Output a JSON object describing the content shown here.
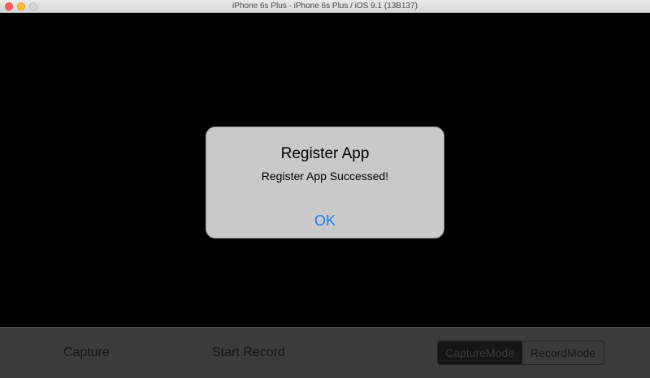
{
  "window": {
    "title": "iPhone 6s Plus - iPhone 6s Plus / iOS 9.1 (13B137)"
  },
  "alert": {
    "title": "Register App",
    "message": "Register App Successed!",
    "button": "OK"
  },
  "toolbar": {
    "capture_label": "Capture",
    "record_label": "Start Record",
    "mode_segments": [
      {
        "label": "CaptureMode",
        "selected": true
      },
      {
        "label": "RecordMode",
        "selected": false
      }
    ]
  },
  "colors": {
    "link_blue": "#1a7ff6",
    "alert_background": "#c9c9c9",
    "close_button": "#fc5f57",
    "minimize_button": "#fdbc2e"
  }
}
